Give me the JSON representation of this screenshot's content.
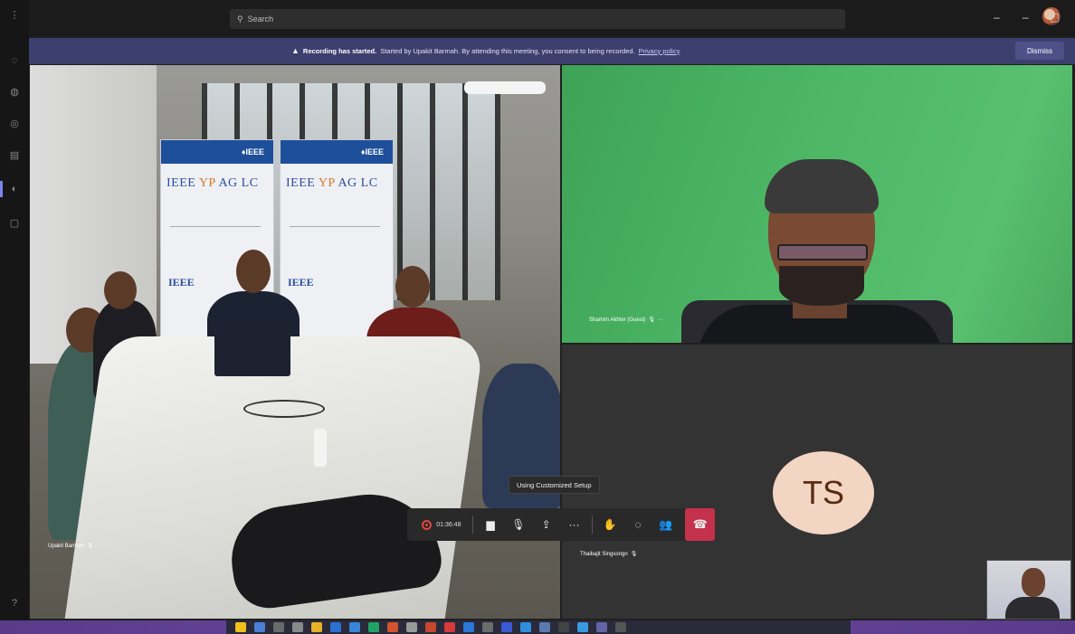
{
  "titlebar": {
    "search_placeholder": "Search",
    "minimize": "–",
    "more": "···",
    "maximize": "▢"
  },
  "banner": {
    "icon": "warning-icon",
    "title": "Recording has started.",
    "text": "Started by Upakit Barmah. By attending this meeting, you consent to being recorded.",
    "link": "Privacy policy",
    "dismiss": "Dismiss"
  },
  "participants": {
    "left_name": "Upakit Barmah",
    "green_name": "Shamim Akhter (Guest)",
    "ts_name": "Thaibajit Singsongn",
    "ts_initials": "TS"
  },
  "room": {
    "banner_logo": "♦IEEE",
    "banner_title_a": "IEEE",
    "banner_title_b": "YP",
    "banner_title_c": "AG LC",
    "banner_footer": "IEEE"
  },
  "tooltip": "Using Customized Setup",
  "controls": {
    "timer": "01:36:48",
    "more": "···"
  },
  "colors": {
    "banner": "#3d3f6e",
    "hangup": "#c4314b",
    "ts_avatar": "#f3d5c3",
    "green_screen": "#4db766"
  }
}
